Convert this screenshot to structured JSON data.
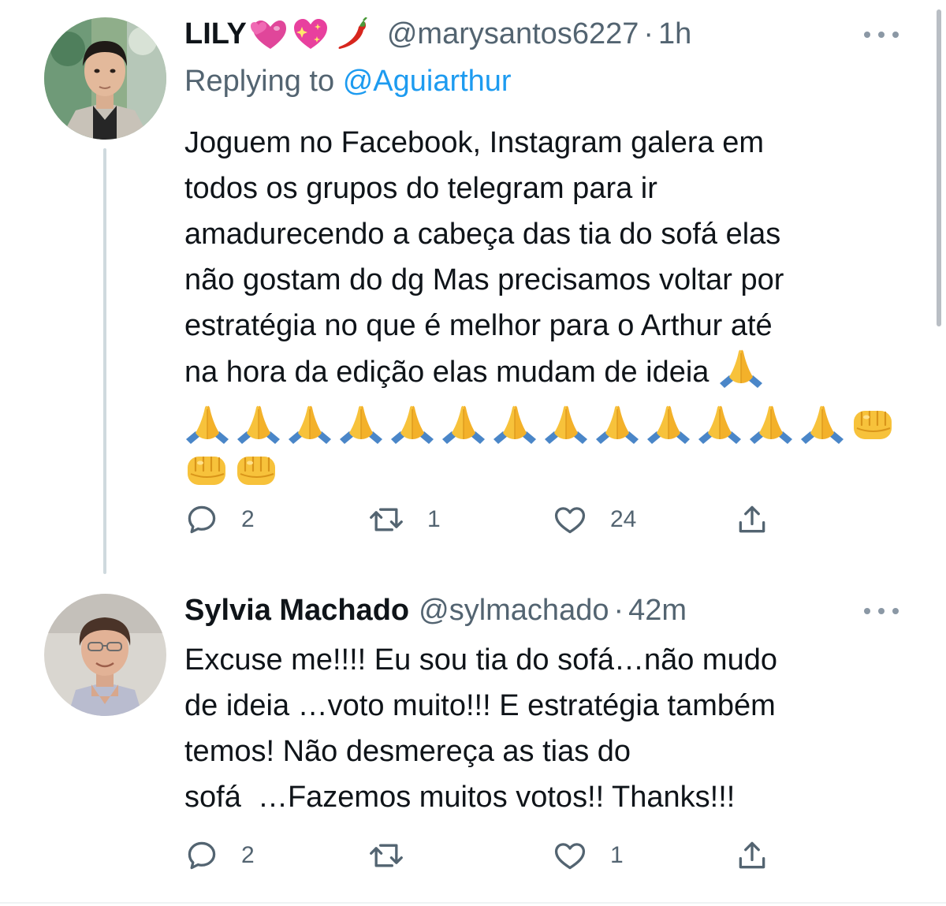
{
  "tweets": [
    {
      "author": {
        "name": "LILY",
        "name_emojis": [
          "revolving-hearts-emoji",
          "sparkling-heart-emoji",
          "chili-pepper-emoji"
        ],
        "handle": "@marysantos6227",
        "separator": "·",
        "time": "1h"
      },
      "replying": {
        "prefix": "Replying to",
        "mention": "@Aguiarthur"
      },
      "text_lines": [
        "Joguem no Facebook, Instagram galera em",
        "todos os grupos do telegram para ir",
        "amadurecendo a cabeça das tia do sofá elas",
        "não gostam do dg Mas precisamos voltar por",
        "estratégia no que é melhor para o Arthur até",
        "na hora da edição elas mudam de ideia"
      ],
      "emojis": {
        "inline_after_text": "folded-hands-emoji",
        "row_1": {
          "folded_hands_count": 13,
          "then": "oncoming-fist-emoji"
        },
        "row_2": {
          "oncoming_fist_count": 2
        }
      },
      "actions": {
        "reply_count": "2",
        "retweet_count": "1",
        "like_count": "24"
      }
    },
    {
      "author": {
        "name": "Sylvia Machado",
        "handle": "@sylmachado",
        "separator": "·",
        "time": "42m"
      },
      "text_lines": [
        "Excuse me!!!! Eu sou tia do sofá…não mudo",
        "de ideia …voto muito!!! E estratégia também",
        "temos! Não desmereça as tias do",
        "sofá  …Fazemos muitos votos!! Thanks!!!"
      ],
      "actions": {
        "reply_count": "2",
        "retweet_count": "",
        "like_count": "1"
      }
    }
  ],
  "colors": {
    "text": "#0f1419",
    "secondary": "#536471",
    "link": "#1d9bf0",
    "thread_line": "#cfd9de",
    "divider": "#eff3f4"
  }
}
